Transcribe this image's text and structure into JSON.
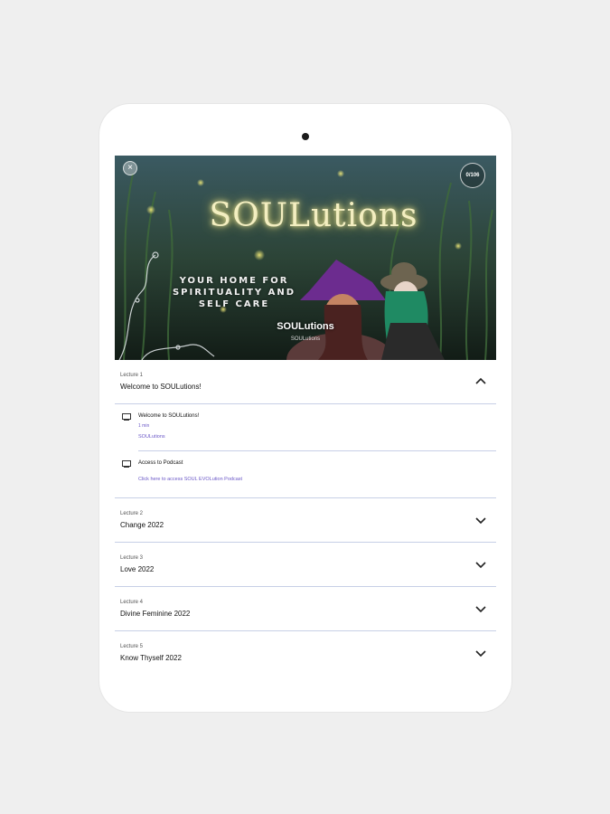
{
  "hero": {
    "script_title": "SOULutions",
    "tagline": [
      "YOUR HOME FOR",
      "SPIRITUALITY AND",
      "SELF CARE"
    ],
    "course_title": "SOULutions",
    "course_sub": "SOULutions",
    "progress": "0/106",
    "close_symbol": "×"
  },
  "lectures": [
    {
      "number": "Lecture 1",
      "title": "Welcome to SOULutions!",
      "expanded": true,
      "items": [
        {
          "title": "Welcome to SOULutions!",
          "meta": "1 min",
          "link": "SOULutions"
        },
        {
          "title": "Access to Podcast",
          "link": "Click here to access SOUL EVOLution Podcast"
        }
      ]
    },
    {
      "number": "Lecture 2",
      "title": "Change 2022",
      "expanded": false
    },
    {
      "number": "Lecture 3",
      "title": "Love 2022",
      "expanded": false
    },
    {
      "number": "Lecture 4",
      "title": "Divine Feminine 2022",
      "expanded": false
    },
    {
      "number": "Lecture 5",
      "title": "Know Thyself 2022",
      "expanded": false
    }
  ],
  "icons": {
    "close": "close-icon",
    "chevron_up": "chevron-up-icon",
    "chevron_down": "chevron-down-icon",
    "video": "video-icon"
  },
  "colors": {
    "accent": "#6a57c7",
    "divider": "#c7cfe6"
  }
}
